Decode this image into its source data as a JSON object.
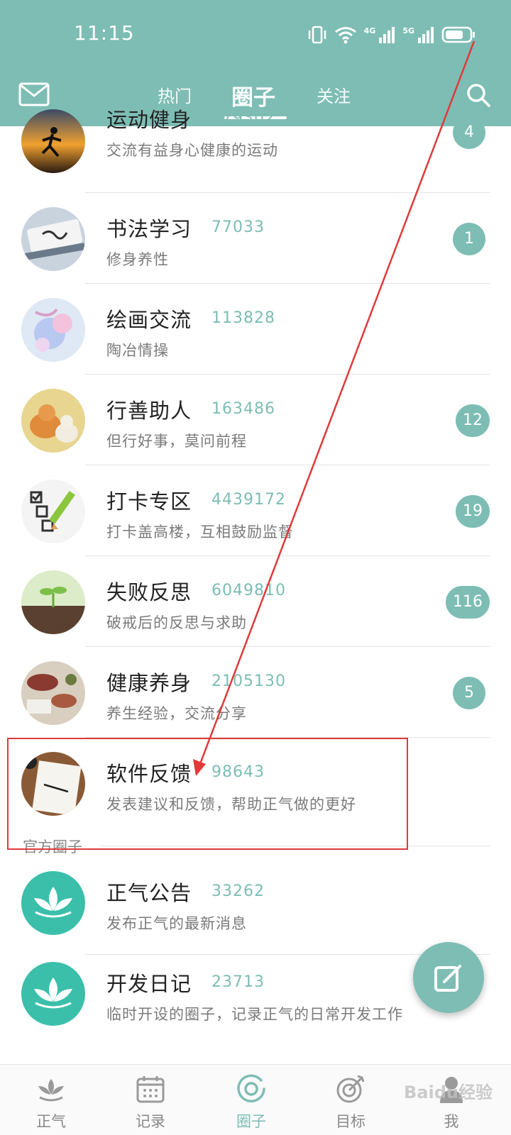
{
  "status_bar": {
    "time": "11:15",
    "net1": "4G",
    "net2": "5G"
  },
  "header": {
    "tabs": [
      {
        "label": "热门"
      },
      {
        "label": "圈子"
      },
      {
        "label": "关注"
      }
    ],
    "active_tab": "圈子"
  },
  "list": {
    "items": [
      {
        "name": "运动健身",
        "count": "279302",
        "desc": "交流有益身心健康的运动",
        "badge": "4"
      },
      {
        "name": "书法学习",
        "count": "77033",
        "desc": "修身养性",
        "badge": "1"
      },
      {
        "name": "绘画交流",
        "count": "113828",
        "desc": "陶冶情操",
        "badge": ""
      },
      {
        "name": "行善助人",
        "count": "163486",
        "desc": "但行好事，莫问前程",
        "badge": "12"
      },
      {
        "name": "打卡专区",
        "count": "4439172",
        "desc": "打卡盖高楼，互相鼓励监督",
        "badge": "19"
      },
      {
        "name": "失败反思",
        "count": "6049810",
        "desc": "破戒后的反思与求助",
        "badge": "116"
      },
      {
        "name": "健康养身",
        "count": "2105130",
        "desc": "养生经验，交流分享",
        "badge": "5"
      },
      {
        "name": "软件反馈",
        "count": "98643",
        "desc": "发表建议和反馈，帮助正气做的更好",
        "badge": ""
      }
    ],
    "section_title": "官方圈子",
    "official": [
      {
        "name": "正气公告",
        "count": "33262",
        "desc": "发布正气的最新消息"
      },
      {
        "name": "开发日记",
        "count": "23713",
        "desc": "临时开设的圈子，记录正气的日常开发工作"
      }
    ]
  },
  "bottom_nav": {
    "items": [
      {
        "label": "正气",
        "icon": "lotus-icon"
      },
      {
        "label": "记录",
        "icon": "calendar-icon"
      },
      {
        "label": "圈子",
        "icon": "circle-icon"
      },
      {
        "label": "目标",
        "icon": "target-icon"
      },
      {
        "label": "我",
        "icon": "user-icon"
      }
    ],
    "active": "圈子"
  },
  "watermark": "Baidu经验",
  "colors": {
    "accent": "#7dbdb4",
    "annotation": "#e03a3a"
  }
}
